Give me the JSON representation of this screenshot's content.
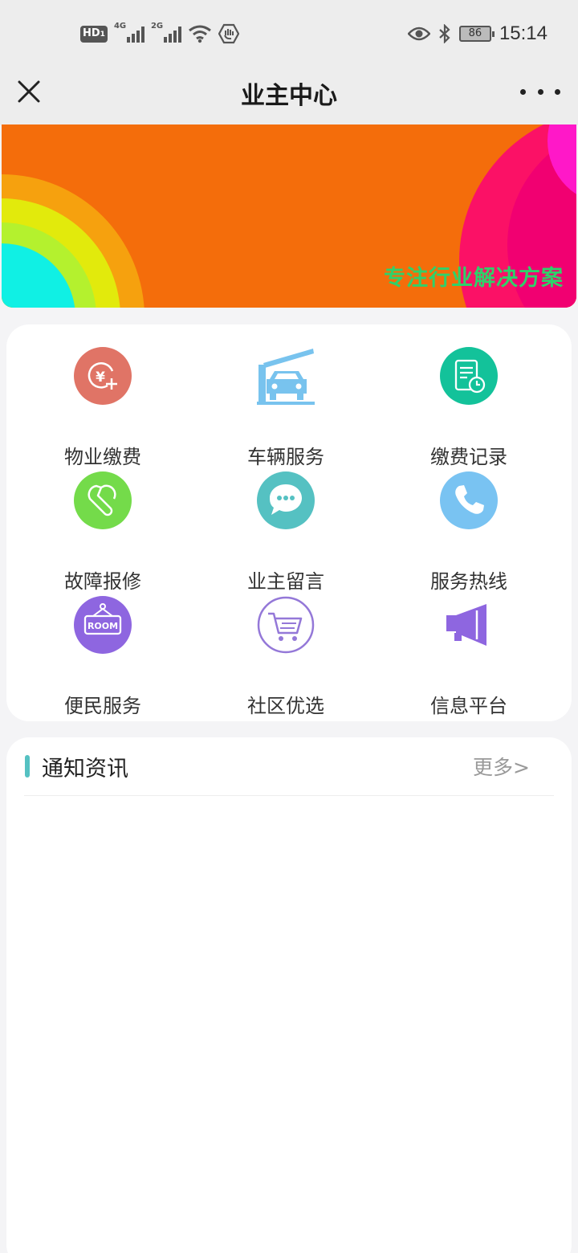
{
  "status_bar": {
    "hd": "HD",
    "sim1": "1",
    "net1": "4G",
    "net2": "2G",
    "battery": "86",
    "time": "15:14"
  },
  "header": {
    "title": "业主中心",
    "close_icon": "close-icon",
    "more_icon": "more-dots-icon"
  },
  "banner": {
    "slogan": "专注行业解决方案",
    "colors": {
      "background": "#f46d0b",
      "slogan": "#2fd16a"
    }
  },
  "services": [
    {
      "label": "物业缴费",
      "icon": "yuan-payment-icon",
      "color": "#e07466"
    },
    {
      "label": "车辆服务",
      "icon": "car-barrier-icon",
      "color": "#78c3ee"
    },
    {
      "label": "缴费记录",
      "icon": "document-clock-icon",
      "color": "#13c29a"
    },
    {
      "label": "故障报修",
      "icon": "wrench-icon",
      "color": "#74db4a"
    },
    {
      "label": "业主留言",
      "icon": "chat-bubble-icon",
      "color": "#55c1c2"
    },
    {
      "label": "服务热线",
      "icon": "phone-icon",
      "color": "#79c3f2"
    },
    {
      "label": "便民服务",
      "icon": "room-sign-icon",
      "color": "#8e66e0"
    },
    {
      "label": "社区优选",
      "icon": "shopping-cart-icon",
      "color": "#9478d8"
    },
    {
      "label": "信息平台",
      "icon": "megaphone-icon",
      "color": "#8e66e0"
    }
  ],
  "news": {
    "title": "通知资讯",
    "more": "更多>",
    "accent": "#55c1c2"
  }
}
